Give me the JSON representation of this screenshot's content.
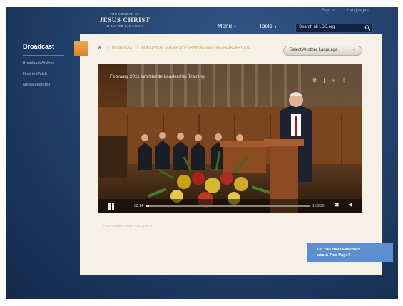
{
  "header": {
    "logo": {
      "line1": "THE CHURCH OF",
      "line2": "JESUS CHRIST",
      "line3": "OF LATTER-DAY SAINTS"
    },
    "sign_in": "Sign In",
    "languages": "Languages",
    "nav": [
      {
        "label": "Menu"
      },
      {
        "label": "Tools"
      }
    ],
    "search_placeholder": "Search all LDS.org"
  },
  "sidebar": {
    "title": "Broadcast",
    "items": [
      {
        "label": "Broadcast Archive"
      },
      {
        "label": "How to Watch"
      },
      {
        "label": "Media Features"
      }
    ]
  },
  "breadcrumb": {
    "home": "A",
    "items": [
      "BROADCAST",
      "WORLDWIDE LEADERSHIP TRAINING MEETING FEBRUARY 2011"
    ]
  },
  "language_button": "Select Another Language",
  "video": {
    "title": "February 2011 Worldwide Leadership Training",
    "time_elapsed": "00:14",
    "time_total": "1:59:25",
    "progress": 0.02
  },
  "below_video_text": "Also Available: Audio/Text Options",
  "feedback": {
    "line1": "Do You Have Feedback",
    "line2": "about This Page?"
  },
  "colors": {
    "brand_blue": "#23426e",
    "accent_orange": "#e59a3e",
    "panel": "#f5f1e7",
    "feedback_blue": "#5d8fd0"
  }
}
